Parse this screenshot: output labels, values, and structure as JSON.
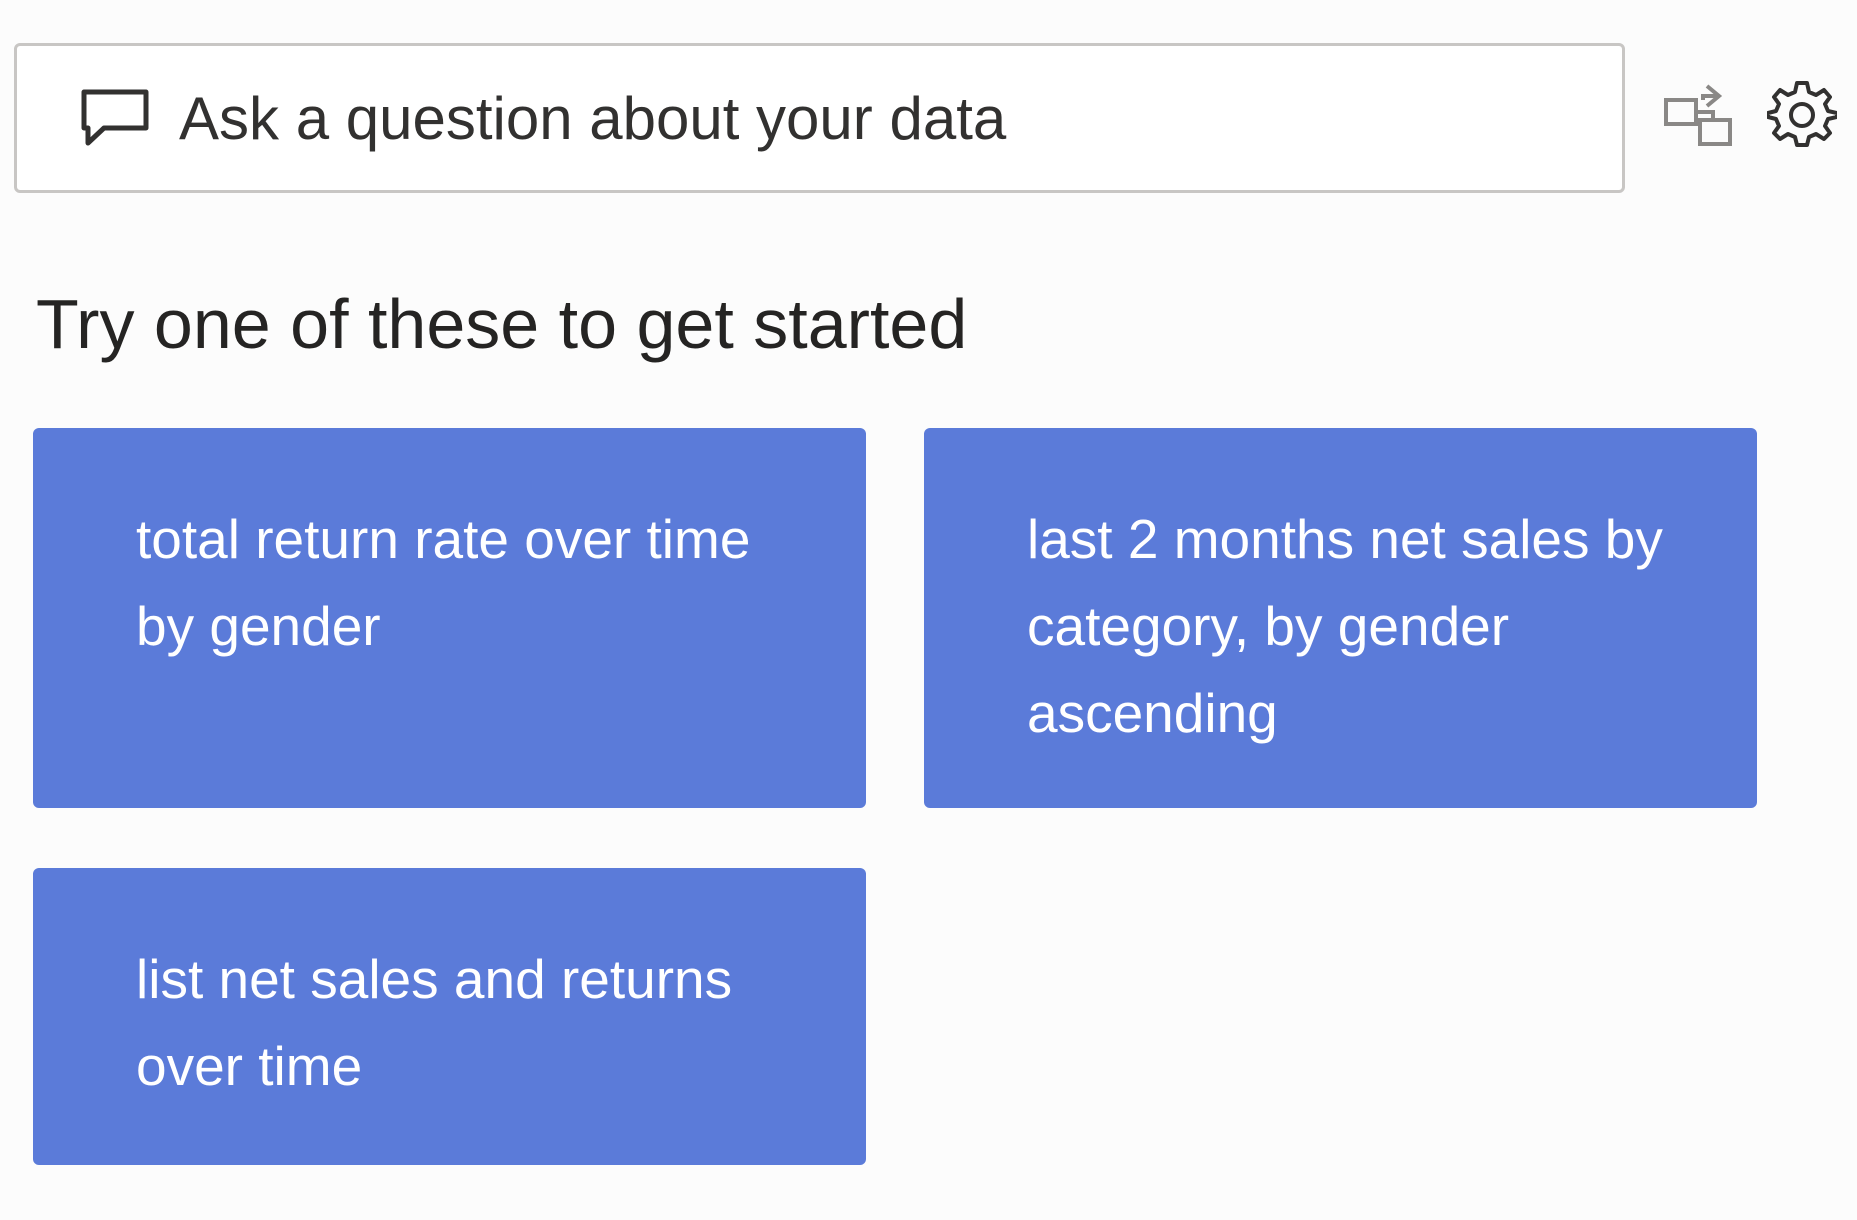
{
  "qna": {
    "placeholder": "Ask a question about your data",
    "input_icon": "chat-bubble-icon"
  },
  "toolbar": {
    "share_icon": "share-icon",
    "settings_icon": "gear-icon"
  },
  "heading": "Try one of these to get started",
  "suggestions": [
    {
      "label": "total return rate over time by gender"
    },
    {
      "label": "last 2 months net sales by category, by gender ascending"
    },
    {
      "label": "list net sales and returns over time"
    }
  ],
  "colors": {
    "tile_background": "#5b7bd9",
    "tile_text": "#ffffff",
    "input_border": "#c8c6c4",
    "page_background": "#fcfcfc"
  }
}
